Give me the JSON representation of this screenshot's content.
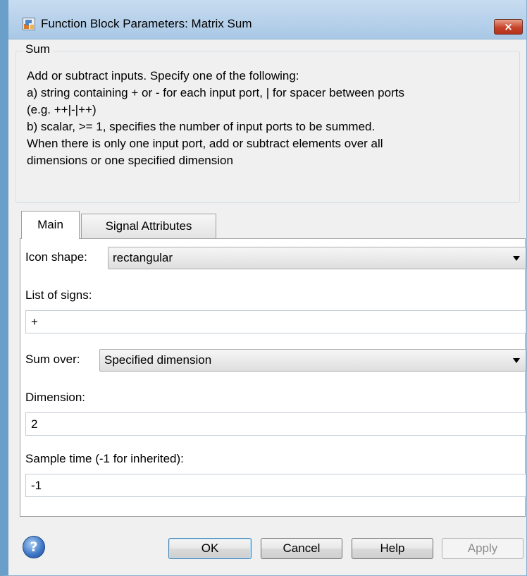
{
  "window": {
    "title": "Function Block Parameters: Matrix Sum",
    "close_label": "×"
  },
  "group": {
    "title": "Sum",
    "description_lines": [
      "Add or subtract inputs.  Specify one of the following:",
      "a) string containing + or - for each input port, | for spacer between ports",
      "(e.g. ++|-|++)",
      "b) scalar, >= 1, specifies the number of input ports to be summed.",
      "When there is only one input port, add or subtract elements over all",
      "dimensions or one specified dimension"
    ]
  },
  "tabs": [
    {
      "label": "Main",
      "active": true
    },
    {
      "label": "Signal Attributes",
      "active": false
    }
  ],
  "fields": {
    "icon_shape": {
      "label": "Icon shape:",
      "value": "rectangular"
    },
    "list_of_signs": {
      "label": "List of signs:",
      "value": "+"
    },
    "sum_over": {
      "label": "Sum over:",
      "value": "Specified dimension"
    },
    "dimension": {
      "label": "Dimension:",
      "value": "2"
    },
    "sample_time": {
      "label": "Sample time (-1 for inherited):",
      "value": "-1"
    }
  },
  "buttons": {
    "ok": "OK",
    "cancel": "Cancel",
    "help": "Help",
    "apply": "Apply"
  },
  "help_icon_glyph": "?",
  "colors": {
    "ok_border": "#3c7fb1",
    "close_button": "#c7442b",
    "apply_disabled_text": "#8d8d8d"
  }
}
